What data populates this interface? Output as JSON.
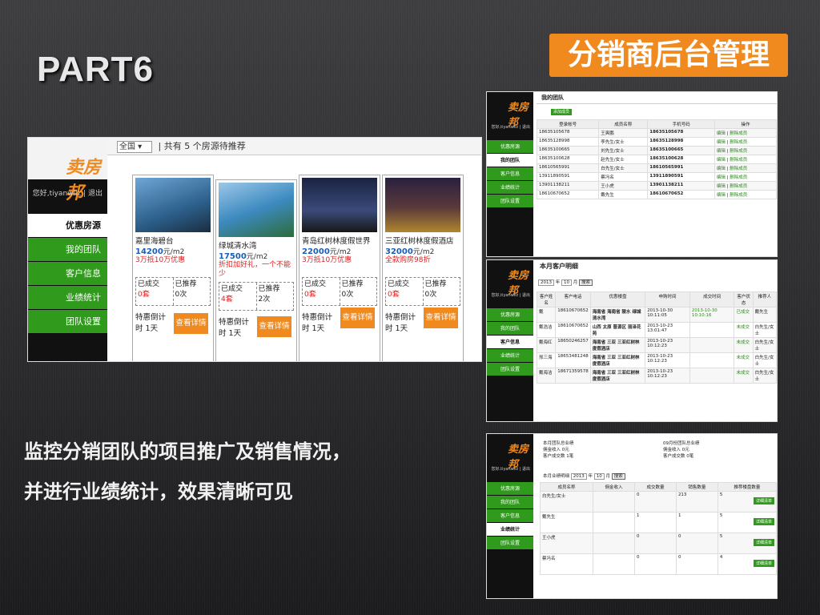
{
  "slide": {
    "part_label": "PART6",
    "title_tag": "分销商后台管理",
    "desc_line1": "监控分销团队的项目推广及销售情况，",
    "desc_line2": "并进行业绩统计，效果清晰可见"
  },
  "app": {
    "logo": "卖房邦",
    "user_text": "您好,tiyanwllz | 退出",
    "nav": [
      "优惠房源",
      "我的团队",
      "客户信息",
      "业绩统计",
      "团队设置"
    ]
  },
  "listing": {
    "filter_value": "全国",
    "summary": "| 共有 5 个房源待推荐",
    "cards": [
      {
        "name": "嘉里海碧台",
        "price": "14200",
        "unit": "元/m2",
        "promo": "3万抵10万优惠",
        "deal_label": "已成交",
        "deal_val": "0套",
        "rec_label": "已推荐",
        "rec_val": "0次",
        "countdown": "特惠倒计时 1天",
        "btn": "查看详情"
      },
      {
        "name": "绿城清水湾",
        "price": "17500",
        "unit": "元/m2",
        "promo": "折扣加好礼，一个不能少",
        "deal_label": "已成交",
        "deal_val": "4套",
        "rec_label": "已推荐",
        "rec_val": "2次",
        "countdown": "特惠倒计时 1天",
        "btn": "查看详情"
      },
      {
        "name": "青岛红树林度假世界",
        "price": "22000",
        "unit": "元/m2",
        "promo": "3万抵10万优惠",
        "deal_label": "已成交",
        "deal_val": "0套",
        "rec_label": "已推荐",
        "rec_val": "0次",
        "countdown": "特惠倒计时 1天",
        "btn": "查看详情"
      },
      {
        "name": "三亚红树林度假酒店",
        "price": "32000",
        "unit": "元/m2",
        "promo": "全款购房98折",
        "deal_label": "已成交",
        "deal_val": "0套",
        "rec_label": "已推荐",
        "rec_val": "0次",
        "countdown": "特惠倒计时 1天",
        "btn": "查看详情"
      }
    ]
  },
  "team": {
    "title": "我的团队",
    "add_btn": "添加成员",
    "headers": [
      "登录帐号",
      "成员名称",
      "手机号码",
      "操作"
    ],
    "rows": [
      [
        "18635105678",
        "王爽鹏",
        "18635105678"
      ],
      [
        "18635128998",
        "李先生/女士",
        "18635128998"
      ],
      [
        "18635100665",
        "刘先生/女士",
        "18635100665"
      ],
      [
        "18635100628",
        "赵先生/女士",
        "18635100628"
      ],
      [
        "18610565991",
        "白先生/女士",
        "18610565991"
      ],
      [
        "13911890591",
        "蔡冯名",
        "13911890591"
      ],
      [
        "13901138211",
        "王小虎",
        "13901138211"
      ],
      [
        "18610670652",
        "戴先生",
        "18610670652"
      ]
    ],
    "op_edit": "编辑",
    "op_del": "删除成员"
  },
  "customers": {
    "title": "本月客户明细",
    "year": "2013",
    "year_suffix": "年",
    "month": "10",
    "month_suffix": "月",
    "search_btn": "搜索",
    "headers": [
      "客户姓名",
      "客户电话",
      "优惠楼盘",
      "申购时间",
      "成交时间",
      "客户状态",
      "推荐人"
    ],
    "rows": [
      [
        "戴",
        "18610670652",
        "海南省 海南省 陵水 绿城清水湾",
        "2013-10-30 10:11:05",
        "2013-10-30 10:10:16",
        "已成交",
        "戴先生"
      ],
      [
        "戴浩洁",
        "18610670652",
        "山西 太原 晋源区 丽泽花苑",
        "2013-10-23 13:01:47",
        "",
        "未成交",
        "白先生/女士"
      ],
      [
        "戴海红",
        "18650246257",
        "海南省 三亚 三亚红树林度假酒店",
        "2013-10-23 10:12:23",
        "",
        "未成交",
        "白先生/女士"
      ],
      [
        "邢三海",
        "18653481248",
        "海南省 三亚 三亚红树林度假酒店",
        "2013-10-23 10:12:23",
        "",
        "未成交",
        "白先生/女士"
      ],
      [
        "戴海洁",
        "18671359578",
        "海南省 三亚 三亚红树林度假酒店",
        "2013-10-23 10:12:23",
        "",
        "未成交",
        "白先生/女士"
      ]
    ]
  },
  "stats": {
    "summary_left": [
      "本月团队总业绩",
      "佣金收入 0元",
      "客户成交数 1笔"
    ],
    "summary_right": [
      "09月份团队总业绩",
      "佣金收入 0元",
      "客户成交数 0笔"
    ],
    "filter_label": "本月业绩明细",
    "year": "2013",
    "year_suffix": "年",
    "month": "10",
    "month_suffix": "月",
    "search_btn": "搜索",
    "headers": [
      "成员名称",
      "佣金收入",
      "成交数量",
      "销售数量",
      "推荐楼盘数量"
    ],
    "rows": [
      [
        "白先生/女士",
        "",
        "0",
        "213",
        "5"
      ],
      [
        "戴先生",
        "",
        "1",
        "1",
        "5"
      ],
      [
        "王小虎",
        "",
        "0",
        "0",
        "5"
      ],
      [
        "蔡冯名",
        "",
        "0",
        "0",
        "4"
      ]
    ],
    "detail_btn": "详细清单"
  }
}
